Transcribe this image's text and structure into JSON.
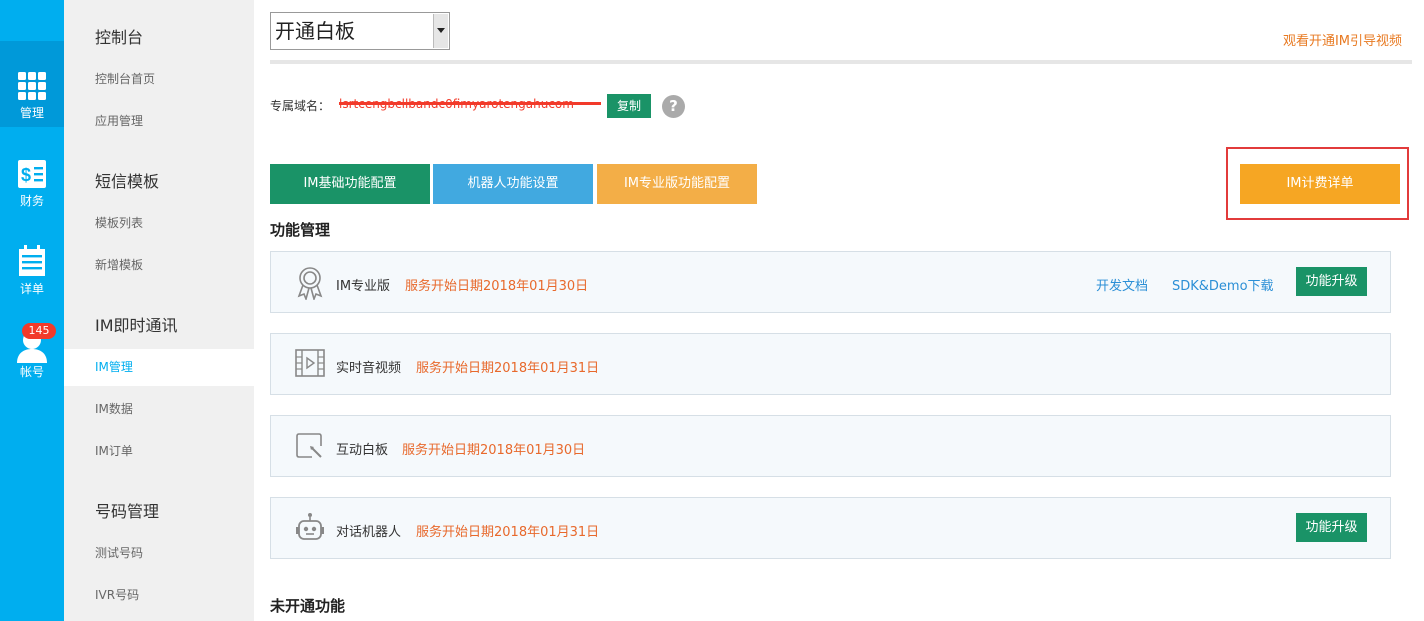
{
  "rail": {
    "items": [
      {
        "label": "管理",
        "icon": "grid-icon"
      },
      {
        "label": "财务",
        "icon": "finance-icon"
      },
      {
        "label": "详单",
        "icon": "calendar-icon"
      },
      {
        "label": "帐号",
        "icon": "user-icon"
      }
    ],
    "badge": "145"
  },
  "menu": {
    "sections": [
      {
        "title": "控制台",
        "items": [
          "控制台首页",
          "应用管理"
        ]
      },
      {
        "title": "短信模板",
        "items": [
          "模板列表",
          "新增模板"
        ]
      },
      {
        "title": "IM即时通讯",
        "items": [
          "IM管理",
          "IM数据",
          "IM订单"
        ]
      },
      {
        "title": "号码管理",
        "items": [
          "测试号码",
          "IVR号码"
        ]
      }
    ],
    "active_item": "IM管理"
  },
  "main": {
    "select_value": "开通白板",
    "guide_link": "观看开通IM引导视频",
    "domain_label": "专属域名：",
    "domain_value": "lsrtcengbcllbandc0fimyarotengahucom",
    "copy_label": "复制",
    "help_glyph": "?",
    "tabs": [
      {
        "label": "IM基础功能配置",
        "color": "#1a9367"
      },
      {
        "label": "机器人功能设置",
        "color": "#41a9e0"
      },
      {
        "label": "IM专业版功能配置",
        "color": "#f3ae47"
      }
    ],
    "billing_label": "IM计费详单",
    "section_active": "功能管理",
    "section_inactive": "未开通功能",
    "features": [
      {
        "name": "IM专业版",
        "date": "服务开始日期2018年01月30日",
        "icon": "award-icon",
        "links": [
          "开发文档",
          "SDK&Demo下载"
        ],
        "upgrade": "功能升级"
      },
      {
        "name": "实时音视频",
        "date": "服务开始日期2018年01月31日",
        "icon": "video-icon"
      },
      {
        "name": "互动白板",
        "date": "服务开始日期2018年01月30日",
        "icon": "whiteboard-icon"
      },
      {
        "name": "对话机器人",
        "date": "服务开始日期2018年01月31日",
        "icon": "robot-icon",
        "upgrade": "功能升级"
      }
    ]
  }
}
